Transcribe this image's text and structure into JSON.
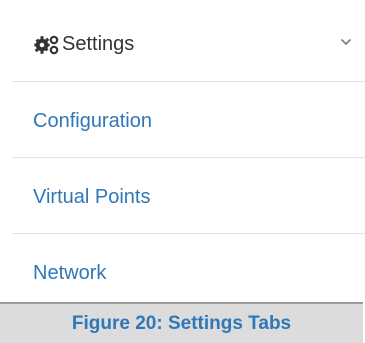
{
  "menu": {
    "header_label": "Settings",
    "header_icon": "gears-icon",
    "expand_icon": "chevron-down-icon",
    "items": [
      {
        "label": "Configuration"
      },
      {
        "label": "Virtual Points"
      },
      {
        "label": "Network"
      }
    ]
  },
  "caption": "Figure 20: Settings Tabs",
  "colors": {
    "link": "#2f78b7",
    "header_text": "#333333",
    "divider": "#e3e3e3",
    "caption_background": "#dcdcdc"
  }
}
